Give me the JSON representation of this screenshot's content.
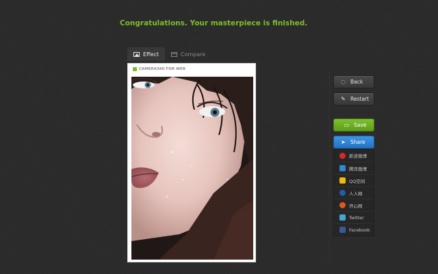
{
  "headline": "Congratulations. Your masterpiece is finished.",
  "tabs": [
    {
      "label": "Effect",
      "icon": "image-icon",
      "active": true
    },
    {
      "label": "Compare",
      "icon": "compare-icon",
      "active": false
    }
  ],
  "preview": {
    "watermark": "CAMERA360 FOR WEB"
  },
  "actions": {
    "back_label": "Back",
    "restart_label": "Restart",
    "save_label": "Save",
    "share_label": "Share"
  },
  "share_targets": [
    {
      "label": "新浪微博",
      "icon": "weibo-icon",
      "color": "#d8282a"
    },
    {
      "label": "腾讯微博",
      "icon": "tencent-weibo-icon",
      "color": "#2a8bd1"
    },
    {
      "label": "QQ空间",
      "icon": "qzone-icon",
      "color": "#f2b80c"
    },
    {
      "label": "人人网",
      "icon": "renren-icon",
      "color": "#1f5fa8"
    },
    {
      "label": "开心网",
      "icon": "kaixin-icon",
      "color": "#e2561f"
    },
    {
      "label": "Twitter",
      "icon": "twitter-icon",
      "color": "#3fa6d8"
    },
    {
      "label": "Facebook",
      "icon": "facebook-icon",
      "color": "#3b5998"
    }
  ],
  "colors": {
    "accent_green": "#7cbd2b",
    "share_blue": "#2d82d6"
  }
}
